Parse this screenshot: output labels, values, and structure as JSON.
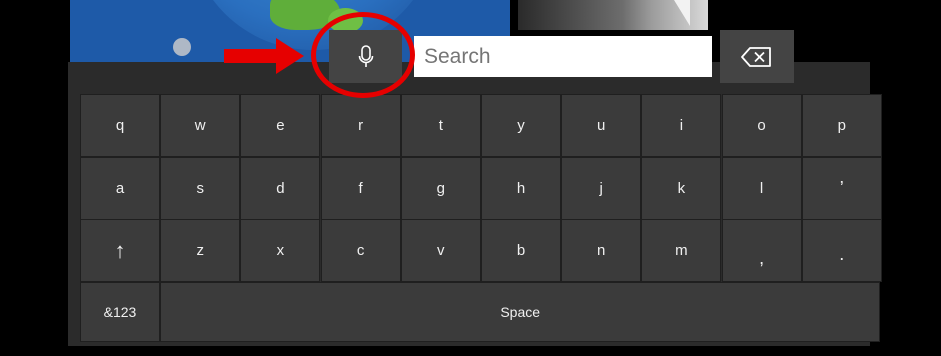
{
  "search": {
    "placeholder": "Search"
  },
  "keyboard": {
    "rows": [
      [
        "q",
        "w",
        "e",
        "r",
        "t",
        "y",
        "u",
        "i",
        "o",
        "p"
      ],
      [
        "a",
        "s",
        "d",
        "f",
        "g",
        "h",
        "j",
        "k",
        "l",
        "’"
      ],
      [
        "↑",
        "z",
        "x",
        "c",
        "v",
        "b",
        "n",
        "m",
        ",",
        "."
      ]
    ],
    "symbols_label": "&123",
    "space_label": "Space"
  },
  "icons": {
    "mic": "microphone-icon",
    "backspace": "backspace-icon",
    "shift": "shift-arrow-icon"
  },
  "colors": {
    "annotation_red": "#e60000",
    "key": "#3b3b3b",
    "panel": "#2b2b2b"
  }
}
